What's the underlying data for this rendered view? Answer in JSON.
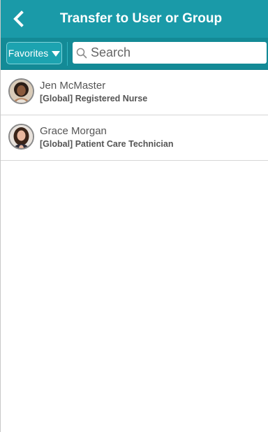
{
  "header": {
    "title": "Transfer to User or Group",
    "back_icon": "chevron-left-icon"
  },
  "toolbar": {
    "filter_label": "Favorites",
    "search_placeholder": "Search",
    "search_value": ""
  },
  "users": [
    {
      "name": "Jen McMaster",
      "role": "[Global] Registered Nurse"
    },
    {
      "name": "Grace Morgan",
      "role": "[Global] Patient Care Technician"
    }
  ],
  "colors": {
    "app_bar": "#1a9aa8",
    "toolbar": "#138a96",
    "text": "#555555"
  }
}
